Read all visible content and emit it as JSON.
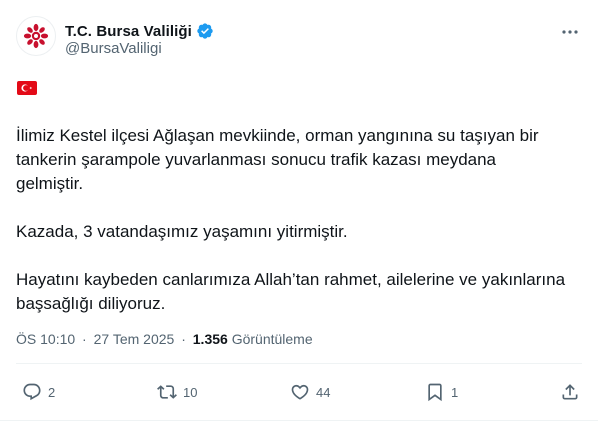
{
  "account": {
    "display_name": "T.C. Bursa Valiliği",
    "handle": "@BursaValiligi",
    "verified_icon": "verified-badge-icon"
  },
  "flag_icon": "turkish-flag-icon",
  "colors": {
    "text": "#0f1419",
    "secondary": "#536471",
    "verified": "#1d9bf0",
    "flag_red": "#e30a17",
    "emblem_red": "#c8102e"
  },
  "tweet": {
    "p1_line1": "İlimiz Kestel ilçesi Ağlaşan mevkiinde, orman yangınına su taşıyan bir",
    "p1_line2": "tankerin şarampole yuvarlanması sonucu trafik kazası meydana",
    "p1_line3": "gelmiştir.",
    "p2_line1": "Kazada, 3 vatandaşımız yaşamını yitirmiştir.",
    "p3_line1": "Hayatını kaybeden canlarımıza Allah’tan rahmet, ailelerine ve yakınlarına",
    "p3_line2": "başsağlığı diliyoruz."
  },
  "meta": {
    "time": "ÖS 10:10",
    "separator": "·",
    "date": "27 Tem 2025",
    "views_count": "1.356",
    "views_label": "Görüntüleme"
  },
  "actions": {
    "reply": {
      "icon": "reply-icon",
      "count": "2"
    },
    "retweet": {
      "icon": "retweet-icon",
      "count": "10"
    },
    "like": {
      "icon": "heart-icon",
      "count": "44"
    },
    "bookmark": {
      "icon": "bookmark-icon",
      "count": "1"
    },
    "share": {
      "icon": "share-icon"
    }
  }
}
